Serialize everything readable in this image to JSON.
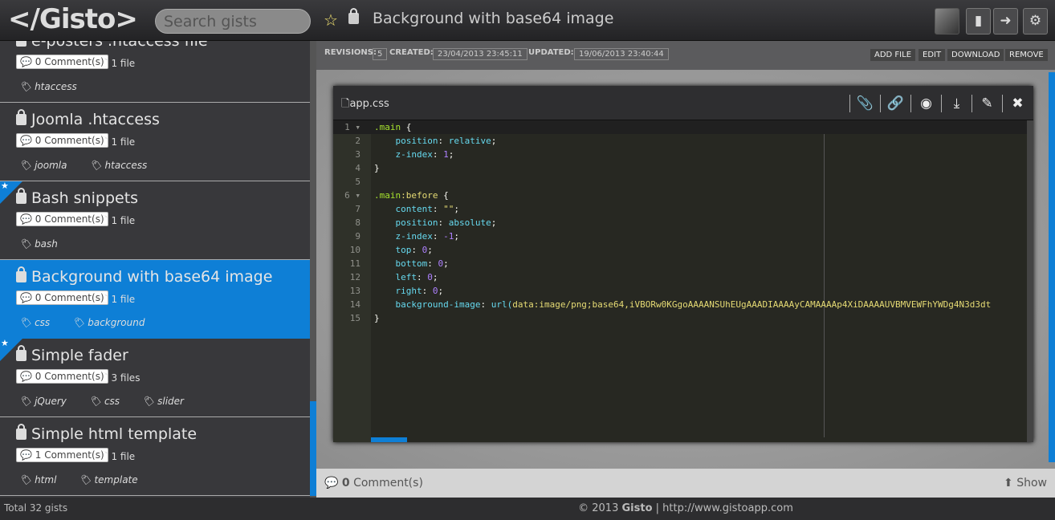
{
  "app": {
    "logo": "</Gisto>",
    "search_placeholder": "Search gists"
  },
  "header": {
    "title": "Background with base64 image",
    "icons": [
      "star-icon",
      "lock-icon",
      "avatar",
      "new-file-icon",
      "logout-icon",
      "gear-icon"
    ]
  },
  "sidebar": {
    "items": [
      {
        "title": "e-posters .htaccess file",
        "comments": "0 Comment(s)",
        "files": "1 file",
        "tags": [
          "htaccess"
        ],
        "starred": false,
        "active": false
      },
      {
        "title": "Joomla .htaccess",
        "comments": "0 Comment(s)",
        "files": "1 file",
        "tags": [
          "joomla",
          "htaccess"
        ],
        "starred": false,
        "active": false
      },
      {
        "title": "Bash snippets",
        "comments": "0 Comment(s)",
        "files": "1 file",
        "tags": [
          "bash"
        ],
        "starred": true,
        "active": false
      },
      {
        "title": "Background with base64 image",
        "comments": "0 Comment(s)",
        "files": "1 file",
        "tags": [
          "css",
          "background"
        ],
        "starred": false,
        "active": true
      },
      {
        "title": "Simple fader",
        "comments": "0 Comment(s)",
        "files": "3 files",
        "tags": [
          "jQuery",
          "css",
          "slider"
        ],
        "starred": true,
        "active": false
      },
      {
        "title": "Simple html template",
        "comments": "1 Comment(s)",
        "files": "1 file",
        "tags": [
          "html",
          "template"
        ],
        "starred": false,
        "active": false
      }
    ],
    "footer": "Total 32 gists"
  },
  "meta": {
    "revisions_label": "REVISIONS:",
    "revisions": "5",
    "created_label": "CREATED:",
    "created": "23/04/2013 23:45:11",
    "updated_label": "UPDATED:",
    "updated": "19/06/2013 23:40:44",
    "actions": [
      "ADD FILE",
      "EDIT",
      "DOWNLOAD",
      "REMOVE"
    ]
  },
  "editor": {
    "filename": "app.css",
    "icons": [
      "paperclip-icon",
      "link-icon",
      "github-icon",
      "download-icon",
      "pencil-icon",
      "close-icon"
    ]
  },
  "comments": {
    "count": "0",
    "label": " Comment(s)",
    "show": "Show"
  },
  "footer": {
    "copy": "© 2013 ",
    "brand": "Gisto",
    "rest": " | http://www.gistoapp.com"
  },
  "colors": {
    "accent": "#0e7fd6",
    "editor_bg": "#272822"
  }
}
